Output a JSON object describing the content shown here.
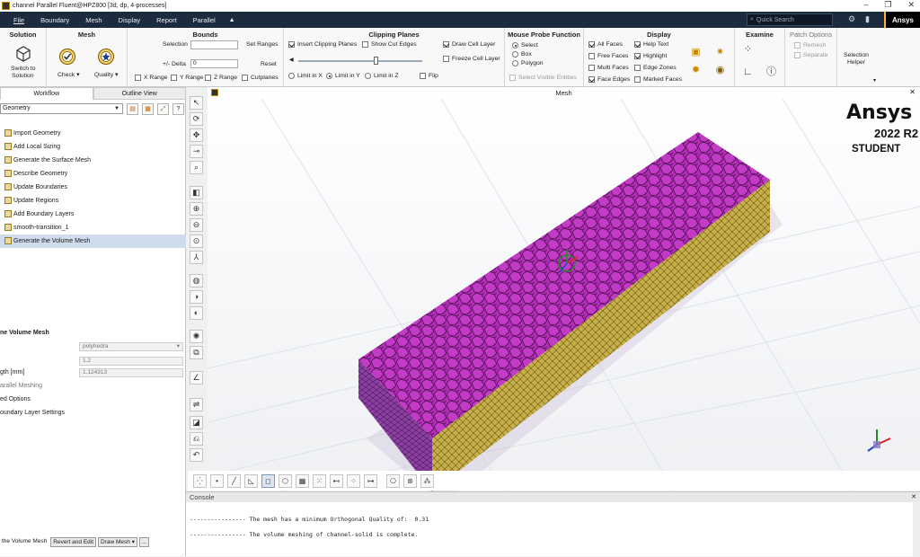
{
  "window": {
    "title": "channel Parallel Fluent@HPZ800 [3d, dp, 4-processes]"
  },
  "menu": {
    "items": [
      "File",
      "Boundary",
      "Mesh",
      "Display",
      "Report",
      "Parallel"
    ],
    "search_placeholder": "Quick Search",
    "brand": "Ansys"
  },
  "ribbon": {
    "solution": {
      "header": "Solution",
      "switch_label_1": "Switch to",
      "switch_label_2": "Solution"
    },
    "mesh": {
      "header": "Mesh",
      "check": "Check",
      "quality": "Quality"
    },
    "bounds": {
      "header": "Bounds",
      "selection": "Selection",
      "set_ranges": "Set Ranges",
      "delta_label": "+/- Delta",
      "delta_value": "0",
      "reset": "Reset",
      "x_range": "X Range",
      "y_range": "Y Range",
      "z_range": "Z Range",
      "cutplanes": "Cutplanes"
    },
    "clipping": {
      "header": "Clipping Planes",
      "insert": "Insert Clipping Planes",
      "show_cut_edges": "Show Cut Edges",
      "draw_cell_layer": "Draw Cell Layer",
      "freeze_cell_layer": "Freeze Cell Layer",
      "limit_x": "Limit in X",
      "limit_y": "Limit in Y",
      "limit_z": "Limit in Z",
      "flip": "Flip",
      "slider_position": 0.63
    },
    "probe": {
      "header": "Mouse Probe Function",
      "select": "Select",
      "box": "Box",
      "polygon": "Polygon",
      "select_visible": "Select Visible Entities"
    },
    "display": {
      "header": "Display",
      "all_faces": "All Faces",
      "free_faces": "Free Faces",
      "multi_faces": "Multi Faces",
      "face_edges": "Face Edges",
      "help_text": "Help Text",
      "highlight": "Highlight",
      "edge_zones": "Edge Zones",
      "marked_faces": "Marked Faces"
    },
    "examine": {
      "header": "Examine"
    },
    "patch": {
      "header": "Patch Options",
      "remesh": "Remesh",
      "separate": "Separate"
    },
    "selection_helper": {
      "line1": "Selection",
      "line2": "Helper"
    }
  },
  "left": {
    "tabs": [
      "Workflow",
      "Outline View"
    ],
    "workflow_select": "Geometry",
    "tasks": [
      "Import Geometry",
      "Add Local Sizing",
      "Generate the Surface Mesh",
      "Describe Geometry",
      "Update Boundaries",
      "Update Regions",
      "Add Boundary Layers",
      "smooth-transition_1",
      "Generate the Volume Mesh"
    ],
    "section_title": "ne Volume Mesh",
    "fields": [
      {
        "label": "",
        "value": "polyhedra"
      },
      {
        "label": "",
        "value": "1.2"
      },
      {
        "label": "gth [mm]",
        "value": "1.124313"
      }
    ],
    "options": [
      "arallel Meshing",
      "ed Options",
      "oundary Layer Settings"
    ],
    "bottom": [
      "the Volume Mesh",
      "Revert and Edit",
      "Draw Mesh",
      "..."
    ]
  },
  "viewport": {
    "title": "Mesh",
    "brand_name": "Ansys",
    "brand_version": "2022 R2",
    "brand_edition": "STUDENT"
  },
  "console": {
    "title": "Console",
    "lines": [
      "---------------- The mesh has a minimum Orthogonal Quality of:  0.31",
      "---------------- The volume meshing of channel-solid is complete."
    ]
  },
  "colors": {
    "menubar": "#1d2b3f",
    "mesh_top": "#b52eb8",
    "mesh_side": "#c7b04a",
    "accent": "#ffb71b"
  }
}
